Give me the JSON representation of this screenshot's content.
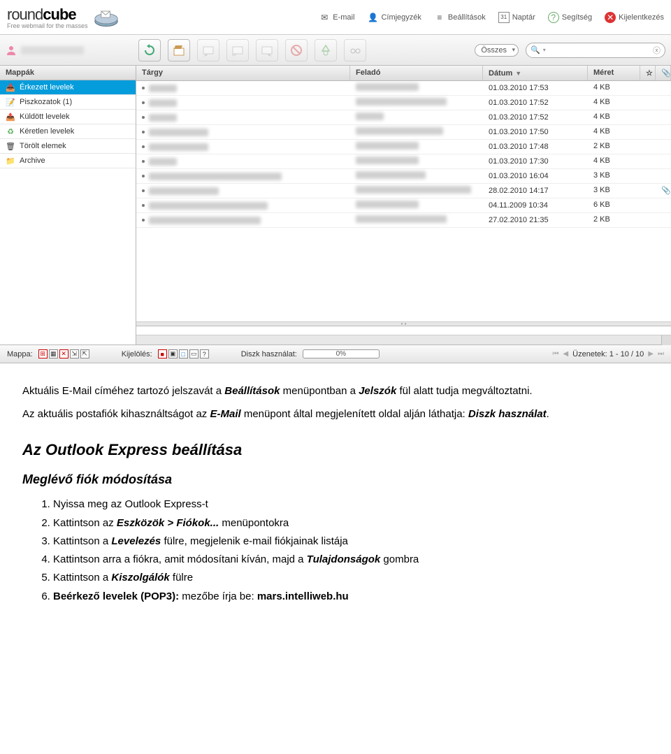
{
  "brand": {
    "name_a": "round",
    "name_b": "cube",
    "tagline": "Free webmail for the masses"
  },
  "topnav": {
    "email": "E-mail",
    "addressbook": "Címjegyzék",
    "settings": "Beállítások",
    "calendar": "Naptár",
    "help": "Segítség",
    "logout": "Kijelentkezés"
  },
  "toolbar": {
    "filter": "Összes"
  },
  "sidebar": {
    "header": "Mappák",
    "folders": [
      {
        "label": "Érkezett levelek",
        "selected": true
      },
      {
        "label": "Piszkozatok (1)",
        "selected": false
      },
      {
        "label": "Küldött levelek",
        "selected": false
      },
      {
        "label": "Kéretlen levelek",
        "selected": false
      },
      {
        "label": "Törölt elemek",
        "selected": false
      },
      {
        "label": "Archive",
        "selected": false
      }
    ]
  },
  "columns": {
    "subject": "Tárgy",
    "from": "Feladó",
    "date": "Dátum",
    "size": "Méret"
  },
  "messages": [
    {
      "date": "01.03.2010 17:53",
      "size": "4 KB",
      "att": false,
      "sw": 40,
      "fw": 90
    },
    {
      "date": "01.03.2010 17:52",
      "size": "4 KB",
      "att": false,
      "sw": 40,
      "fw": 130
    },
    {
      "date": "01.03.2010 17:52",
      "size": "4 KB",
      "att": false,
      "sw": 40,
      "fw": 40
    },
    {
      "date": "01.03.2010 17:50",
      "size": "4 KB",
      "att": false,
      "sw": 85,
      "fw": 125
    },
    {
      "date": "01.03.2010 17:48",
      "size": "2 KB",
      "att": false,
      "sw": 85,
      "fw": 90
    },
    {
      "date": "01.03.2010 17:30",
      "size": "4 KB",
      "att": false,
      "sw": 40,
      "fw": 90
    },
    {
      "date": "01.03.2010 16:04",
      "size": "3 KB",
      "att": false,
      "sw": 190,
      "fw": 100
    },
    {
      "date": "28.02.2010 14:17",
      "size": "3 KB",
      "att": true,
      "sw": 100,
      "fw": 165
    },
    {
      "date": "04.11.2009 10:34",
      "size": "6 KB",
      "att": false,
      "sw": 170,
      "fw": 90
    },
    {
      "date": "27.02.2010 21:35",
      "size": "2 KB",
      "att": false,
      "sw": 160,
      "fw": 130
    }
  ],
  "status": {
    "folder_label": "Mappa:",
    "select_label": "Kijelölés:",
    "disk_label": "Diszk használat:",
    "disk_value": "0%",
    "pager": "Üzenetek: 1 - 10 / 10"
  },
  "doc": {
    "p1a": "Aktuális E-Mail címéhez tartozó jelszavát a ",
    "p1b": "Beállítások",
    "p1c": " menüpontban a ",
    "p1d": "Jelszók",
    "p1e": " fül alatt tudja megváltoztatni.",
    "p2a": "Az aktuális postafiók kihasználtságot az ",
    "p2b": "E-Mail",
    "p2c": " menüpont által megjelenített oldal alján láthatja: ",
    "p2d": "Diszk használat",
    "p2e": ".",
    "h2": "Az Outlook Express beállítása",
    "h3": "Meglévő fiók módosítása",
    "li1": "Nyissa meg az Outlook Express-t",
    "li2a": "Kattintson az ",
    "li2b": "Eszközök > Fiókok...",
    "li2c": " menüpontokra",
    "li3a": "Kattintson a ",
    "li3b": "Levelezés",
    "li3c": " fülre, megjelenik e-mail fiókjainak listája",
    "li4a": "Kattintson arra a fiókra, amit módosítani kíván, majd a ",
    "li4b": "Tulajdonságok",
    "li4c": " gombra",
    "li5a": "Kattintson a ",
    "li5b": "Kiszolgálók",
    "li5c": " fülre",
    "li6a": "Beérkező levelek (POP3):",
    "li6b": " mezőbe írja be: ",
    "li6c": "mars.intelliweb.hu"
  }
}
